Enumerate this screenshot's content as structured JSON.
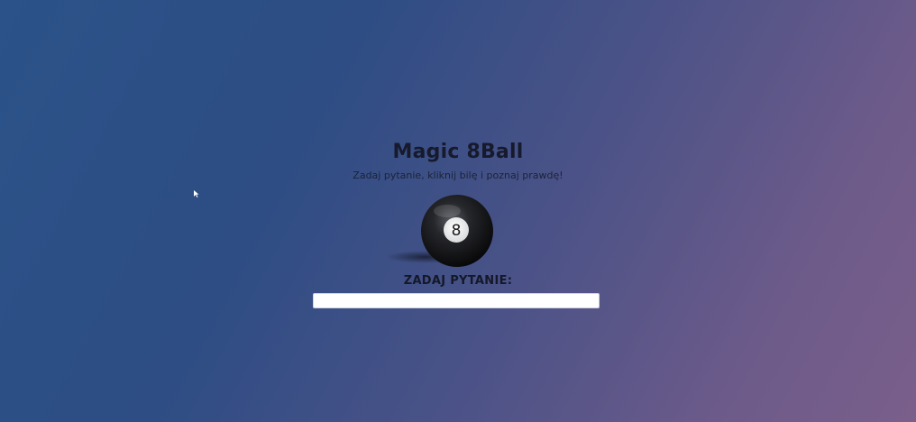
{
  "app": {
    "title": "Magic 8Ball",
    "subtitle": "Zadaj pytanie, kliknij bilę i poznaj prawdę!"
  },
  "ball": {
    "number": "8",
    "icon": "eight-ball-icon"
  },
  "question": {
    "label": "ZADAJ PYTANIE:",
    "value": "",
    "placeholder": ""
  },
  "colors": {
    "background_start": "#2b5389",
    "background_end": "#7a5f8a",
    "text": "#161a2c"
  }
}
